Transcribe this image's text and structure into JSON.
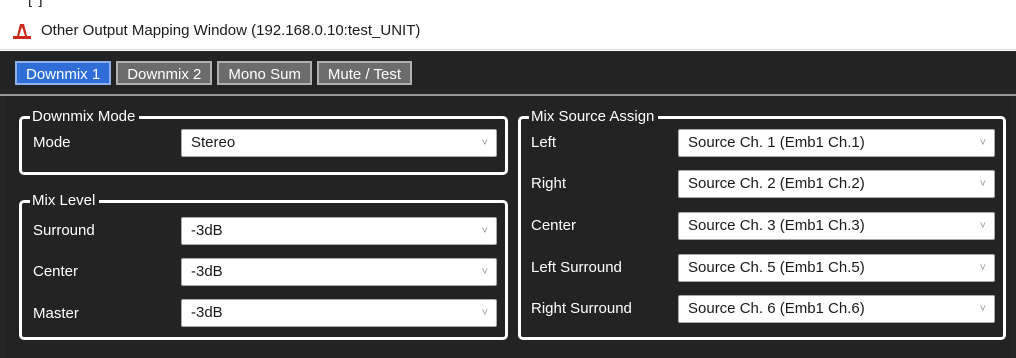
{
  "top_strip_partial": "[ ]",
  "window": {
    "title": "Other Output Mapping Window (192.168.0.10:test_UNIT)",
    "icon": "app-logo-icon",
    "accent": "#cc2a1e"
  },
  "tabs": [
    {
      "label": "Downmix 1",
      "active": true
    },
    {
      "label": "Downmix 2",
      "active": false
    },
    {
      "label": "Mono Sum",
      "active": false
    },
    {
      "label": "Mute / Test",
      "active": false
    }
  ],
  "downmix_mode": {
    "title": "Downmix Mode",
    "rows": [
      {
        "label": "Mode",
        "value": "Stereo"
      }
    ]
  },
  "mix_level": {
    "title": "Mix Level",
    "rows": [
      {
        "label": "Surround",
        "value": "-3dB"
      },
      {
        "label": "Center",
        "value": "-3dB"
      },
      {
        "label": "Master",
        "value": "-3dB"
      }
    ]
  },
  "mix_source_assign": {
    "title": "Mix Source Assign",
    "rows": [
      {
        "label": "Left",
        "value": "Source Ch. 1 (Emb1 Ch.1)"
      },
      {
        "label": "Right",
        "value": "Source Ch. 2 (Emb1 Ch.2)"
      },
      {
        "label": "Center",
        "value": "Source Ch. 3 (Emb1 Ch.3)"
      },
      {
        "label": "Left Surround",
        "value": "Source Ch. 5 (Emb1 Ch.5)"
      },
      {
        "label": "Right Surround",
        "value": "Source Ch. 6 (Emb1 Ch.6)"
      }
    ]
  },
  "dropdown_caret": "˅",
  "colors": {
    "tab_active": "#2e6ed6",
    "tab_inactive": "#6c6c6c",
    "panel_background": "#232323"
  }
}
